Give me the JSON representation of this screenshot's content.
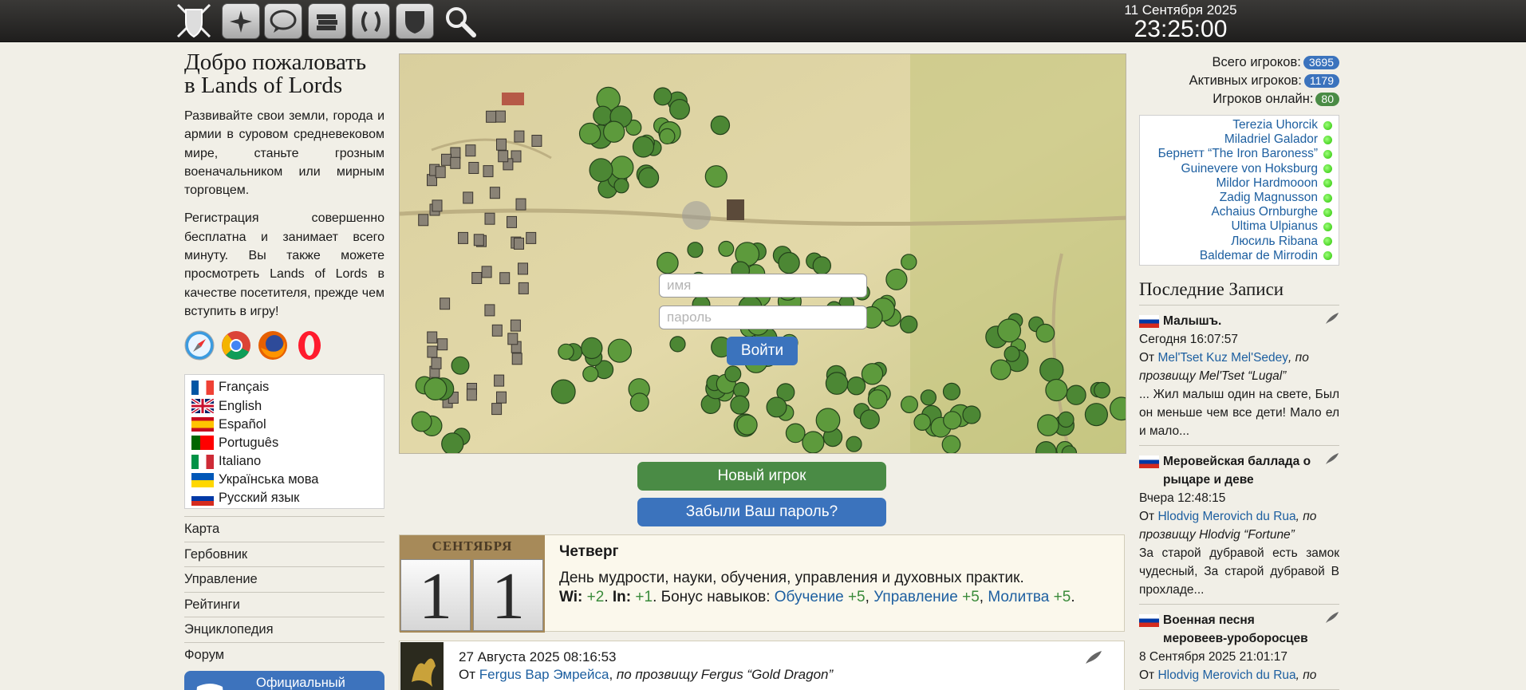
{
  "topbar": {
    "icons": [
      "logo-shield-swords-icon",
      "compass-icon",
      "chat-icon",
      "books-icon",
      "laurel-icon",
      "shield-icon",
      "search-icon"
    ],
    "date": "11 Сентября 2025",
    "time": "23:25:00"
  },
  "left": {
    "welcome_line1": "Добро пожаловать",
    "welcome_line2": "в Lands of Lords",
    "intro": "Развивайте свои земли, города и армии в суровом средневековом мире, станьте грозным военачальником или мирным торговцем.",
    "register": "Регистрация совершенно бесплатна и занимает всего минуту. Вы также можете просмотреть Lands of Lords в качестве посетителя, прежде чем вступить в игру!",
    "browsers": [
      "safari-icon",
      "chrome-icon",
      "firefox-icon",
      "opera-icon"
    ],
    "languages": [
      {
        "label": "Français",
        "flag": "fr"
      },
      {
        "label": "English",
        "flag": "gb"
      },
      {
        "label": "Español",
        "flag": "es"
      },
      {
        "label": "Português",
        "flag": "pt"
      },
      {
        "label": "Italiano",
        "flag": "it"
      },
      {
        "label": "Українська мова",
        "flag": "ua"
      },
      {
        "label": "Русский язык",
        "flag": "ru"
      }
    ],
    "nav": [
      "Карта",
      "Гербовник",
      "Управление",
      "Рейтинги",
      "Энциклопедия",
      "Форум"
    ],
    "discord_label": "Официальный"
  },
  "login": {
    "name_placeholder": "имя",
    "password_placeholder": "пароль",
    "submit": "Войти"
  },
  "buttons": {
    "new_player": "Новый игрок",
    "forgot": "Забыли Ваш пароль?"
  },
  "day": {
    "month": "СЕНТЯБРЯ",
    "digit1": "1",
    "digit2": "1",
    "name": "Четверг",
    "desc": "День мудрости, науки, обучения, управления и духовных практик.",
    "wi_label": "Wi:",
    "wi_value": "+2",
    "in_label": "In:",
    "in_value": "+1",
    "bonus_label": "Бонус навыков:",
    "skill1": "Обучение",
    "skill1_value": "+5",
    "skill2": "Управление",
    "skill2_value": "+5",
    "skill3": "Молитва",
    "skill3_value": "+5"
  },
  "news": {
    "date": "27 Августа 2025 08:16:53",
    "from_prefix": "От",
    "author": "Fergus Вар Эмрейса",
    "nickname": "по прозвищу Fergus “Gold Dragon”"
  },
  "stats": {
    "total_label": "Всего игроков:",
    "total": "3695",
    "active_label": "Активных игроков:",
    "active": "1179",
    "online_label": "Игроков онлайн:",
    "online": "80"
  },
  "online_players": [
    "Terezia Uhorcik",
    "Miladriel Galador",
    "Бернетт “The Iron Baroness”",
    "Guinevere von Hoksburg",
    "Mildor Hardmooon",
    "Zadig Magnusson",
    "Achaius Ornburghe",
    "Ultima Ulpianus",
    "Люсиль Ribana",
    "Baldemar de Mirrodin"
  ],
  "recent": {
    "title": "Последние Записи",
    "posts": [
      {
        "title": "Малышъ.",
        "when": "Сегодня 16:07:57",
        "from": "От",
        "author": "Mel'Tset Kuz Mel'Sedey",
        "nick": ", по прозвищу Mel'Tset “Lugal”",
        "text": "... Жил малыш один на свете, Был он меньше чем все дети! Мало ел и мало..."
      },
      {
        "title": "Меровейская баллада о рыцаре и деве",
        "when": "Вчера 12:48:15",
        "from": "От",
        "author": "Hlodvig Merovich du Rua",
        "nick": ", по прозвищу Hlodvig “Fortune”",
        "text": "За старой дубравой есть замок чудесный, За старой дубравой В прохладе..."
      },
      {
        "title": "Военная песня меровеев-уроборосцев",
        "when": "8 Сентября 2025 21:01:17",
        "from": "От",
        "author": "Hlodvig Merovich du Rua",
        "nick": ", по",
        "text": ""
      }
    ]
  }
}
